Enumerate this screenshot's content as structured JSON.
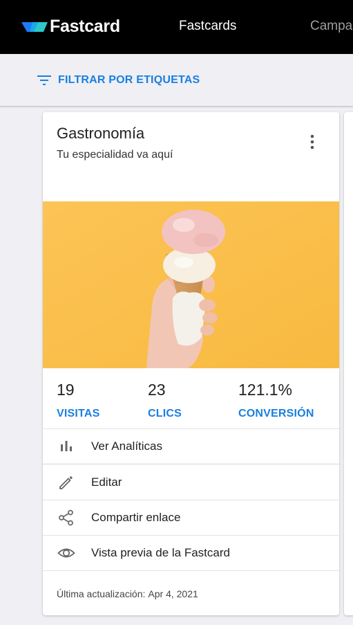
{
  "header": {
    "brand": "Fastcard",
    "nav": [
      {
        "label": "Fastcards",
        "active": true
      },
      {
        "label": "Campa",
        "active": false
      }
    ]
  },
  "filter": {
    "label": "FILTRAR POR ETIQUETAS",
    "icon": "filter-list-icon"
  },
  "card": {
    "title": "Gastronomía",
    "subtitle": "Tu especialidad va aquí",
    "menu_icon": "more-vert-icon",
    "image": {
      "subject": "ice-cream-cone",
      "background_color": "#fbc04e"
    },
    "stats": [
      {
        "value": "19",
        "label": "VISITAS"
      },
      {
        "value": "23",
        "label": "CLICS"
      },
      {
        "value": "121.1%",
        "label": "CONVERSIÓN"
      }
    ],
    "actions": [
      {
        "label": "Ver Analíticas",
        "icon": "bar-chart-icon"
      },
      {
        "label": "Editar",
        "icon": "pencil-icon"
      },
      {
        "label": "Compartir enlace",
        "icon": "share-icon"
      },
      {
        "label": "Vista previa de la Fastcard",
        "icon": "eye-icon"
      }
    ],
    "updated": {
      "label": "Última actualización:",
      "value": "Apr 4, 2021"
    }
  },
  "colors": {
    "topbar": "#000000",
    "accent": "#1a7fe0",
    "page_bg": "#efeff4",
    "logo_blue": "#1d7bf2",
    "logo_cyan": "#2ed3d6"
  }
}
